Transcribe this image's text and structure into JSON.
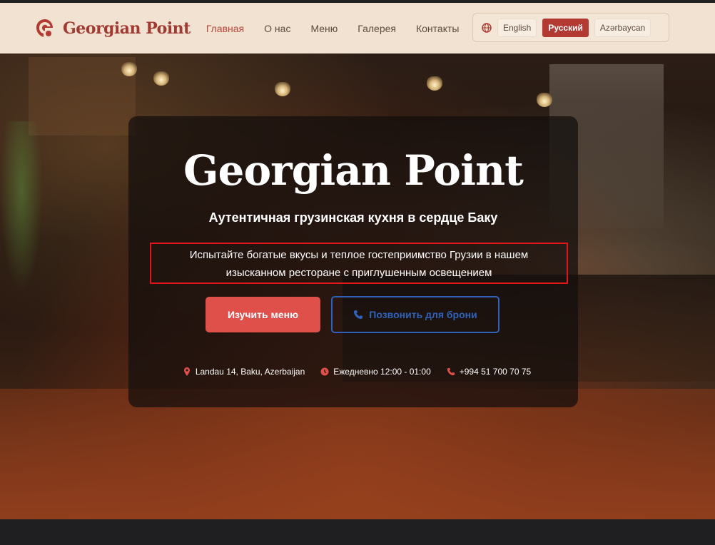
{
  "header": {
    "logo_text": "Georgian Point",
    "nav": [
      {
        "label": "Главная",
        "active": true
      },
      {
        "label": "О нас"
      },
      {
        "label": "Меню"
      },
      {
        "label": "Галерея"
      },
      {
        "label": "Контакты"
      }
    ],
    "languages": [
      {
        "label": "English"
      },
      {
        "label": "Русский",
        "active": true
      },
      {
        "label": "Azərbaycan"
      }
    ],
    "accent_color": "#b23a33"
  },
  "hero": {
    "title": "Georgian Point",
    "subtitle": "Аутентичная грузинская кухня в сердце Баку",
    "description_line1": "Испытайте богатые вкусы и теплое гостеприимство Грузии в нашем",
    "description_line2": "изысканном ресторане с приглушенным освещением",
    "primary_button": "Изучить меню",
    "secondary_button": "Позвонить для брони",
    "info": {
      "address": "Landau 14, Baku, Azerbaijan",
      "hours": "Ежедневно 12:00 - 01:00",
      "phone": "+994 51 700 70 75"
    }
  },
  "icons": [
    "logo-mark-icon",
    "globe-icon",
    "phone-icon",
    "map-pin-icon",
    "clock-icon"
  ],
  "colors": {
    "primary_button": "#e0504b",
    "secondary_button": "#2f62b8",
    "highlight_box": "#e01515"
  }
}
